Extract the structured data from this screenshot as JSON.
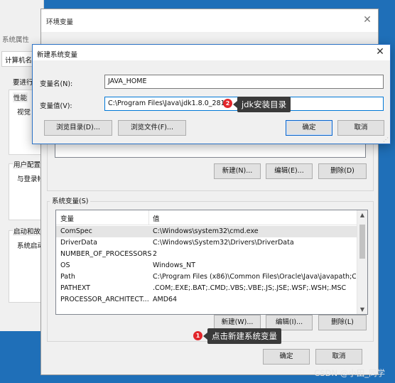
{
  "system_properties": {
    "title": "系统属性",
    "tab": "计算机名",
    "labels": [
      "要进行",
      "性能",
      "视觉",
      "用户配置",
      "与登录帐",
      "启动和故",
      "系统启动"
    ]
  },
  "env_window": {
    "title": "环境变量",
    "user_buttons": {
      "new": "新建(N)...",
      "edit": "编辑(E)...",
      "delete": "删除(D)"
    },
    "system_group_label": "系统变量(S)",
    "table": {
      "columns": [
        "变量",
        "值"
      ],
      "rows": [
        {
          "name": "ComSpec",
          "value": "C:\\Windows\\system32\\cmd.exe"
        },
        {
          "name": "DriverData",
          "value": "C:\\Windows\\System32\\Drivers\\DriverData"
        },
        {
          "name": "NUMBER_OF_PROCESSORS",
          "value": "2"
        },
        {
          "name": "OS",
          "value": "Windows_NT"
        },
        {
          "name": "Path",
          "value": "C:\\Program Files (x86)\\Common Files\\Oracle\\Java\\javapath;C:..."
        },
        {
          "name": "PATHEXT",
          "value": ".COM;.EXE;.BAT;.CMD;.VBS;.VBE;.JS;.JSE;.WSF;.WSH;.MSC"
        },
        {
          "name": "PROCESSOR_ARCHITECT...",
          "value": "AMD64"
        }
      ]
    },
    "system_buttons": {
      "new": "新建(W)...",
      "edit": "编辑(I)...",
      "delete": "删除(L)"
    },
    "ok": "确定",
    "cancel": "取消"
  },
  "new_var_dialog": {
    "title": "新建系统变量",
    "name_label": "变量名(N):",
    "name_value": "JAVA_HOME",
    "value_label": "变量值(V):",
    "value_value": "C:\\Program Files\\Java\\jdk1.8.0_281",
    "browse_dir": "浏览目录(D)...",
    "browse_file": "浏览文件(F)...",
    "ok": "确定",
    "cancel": "取消"
  },
  "annotations": {
    "badge1": "1",
    "callout1": "点击新建系统变量",
    "badge2": "2",
    "callout2": "jdk安装目录"
  },
  "watermark": "CSDN @小田_同学",
  "colors": {
    "desktop": "#1f6fb8",
    "accent": "#0078d7",
    "badge": "#e2262b",
    "callout": "#3a3a3a"
  }
}
